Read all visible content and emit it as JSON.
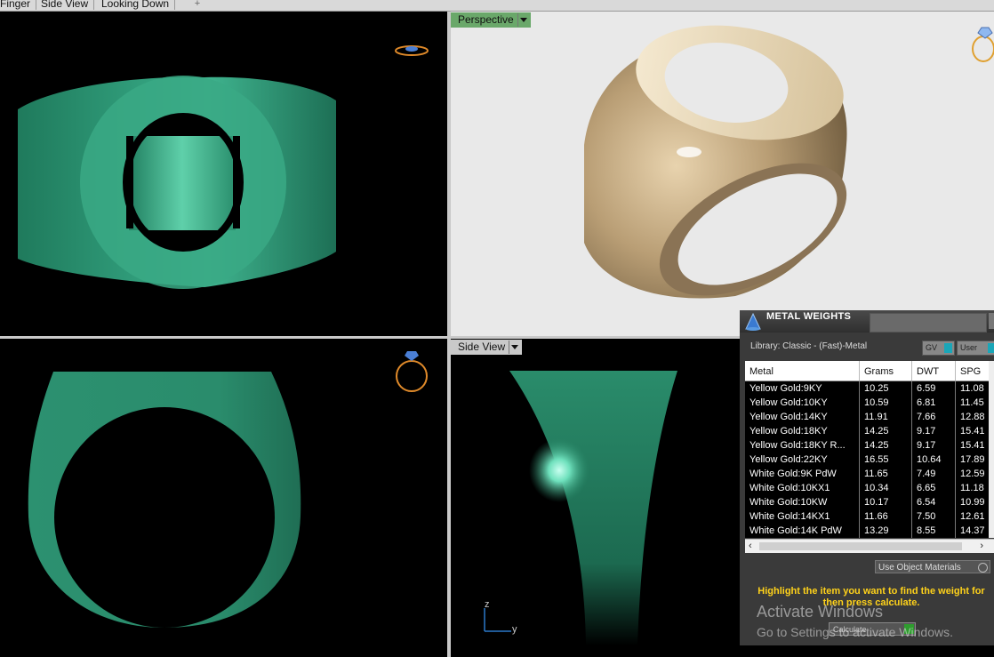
{
  "tabs": [
    "Finger",
    "Side View",
    "Looking Down"
  ],
  "tab_add_icon": "plus-icon",
  "viewports": {
    "perspective_label": "Perspective",
    "side_label": "Side View"
  },
  "axis": {
    "z": "z",
    "y": "y"
  },
  "colors": {
    "ring_green": "#2f9a78",
    "gold": "#cbb48d",
    "panel": "#3a3a3a",
    "hint": "#ffd21a"
  },
  "metal_weights": {
    "title": "METAL WEIGHTS",
    "library": "Library: Classic - (Fast)-Metal",
    "gv_button": "GV",
    "user_button": "User",
    "columns": [
      "Metal",
      "Grams",
      "DWT",
      "SPG"
    ],
    "rows": [
      [
        "Yellow Gold:9KY",
        "10.25",
        "6.59",
        "11.08"
      ],
      [
        "Yellow Gold:10KY",
        "10.59",
        "6.81",
        "11.45"
      ],
      [
        "Yellow Gold:14KY",
        "11.91",
        "7.66",
        "12.88"
      ],
      [
        "Yellow Gold:18KY",
        "14.25",
        "9.17",
        "15.41"
      ],
      [
        "Yellow Gold:18KY R...",
        "14.25",
        "9.17",
        "15.41"
      ],
      [
        "Yellow Gold:22KY",
        "16.55",
        "10.64",
        "17.89"
      ],
      [
        "White Gold:9K PdW",
        "11.65",
        "7.49",
        "12.59"
      ],
      [
        "White Gold:10KX1",
        "10.34",
        "6.65",
        "11.18"
      ],
      [
        "White Gold:10KW",
        "10.17",
        "6.54",
        "10.99"
      ],
      [
        "White Gold:14KX1",
        "11.66",
        "7.50",
        "12.61"
      ],
      [
        "White Gold:14K PdW",
        "13.29",
        "8.55",
        "14.37"
      ]
    ],
    "use_object_materials": "Use Object Materials",
    "hint": "Highlight the item you want to find the weight for then press calculate.",
    "calculate": "Calculate"
  },
  "watermark": {
    "line1": "Activate Windows",
    "line2": "Go to Settings to activate Windows."
  }
}
